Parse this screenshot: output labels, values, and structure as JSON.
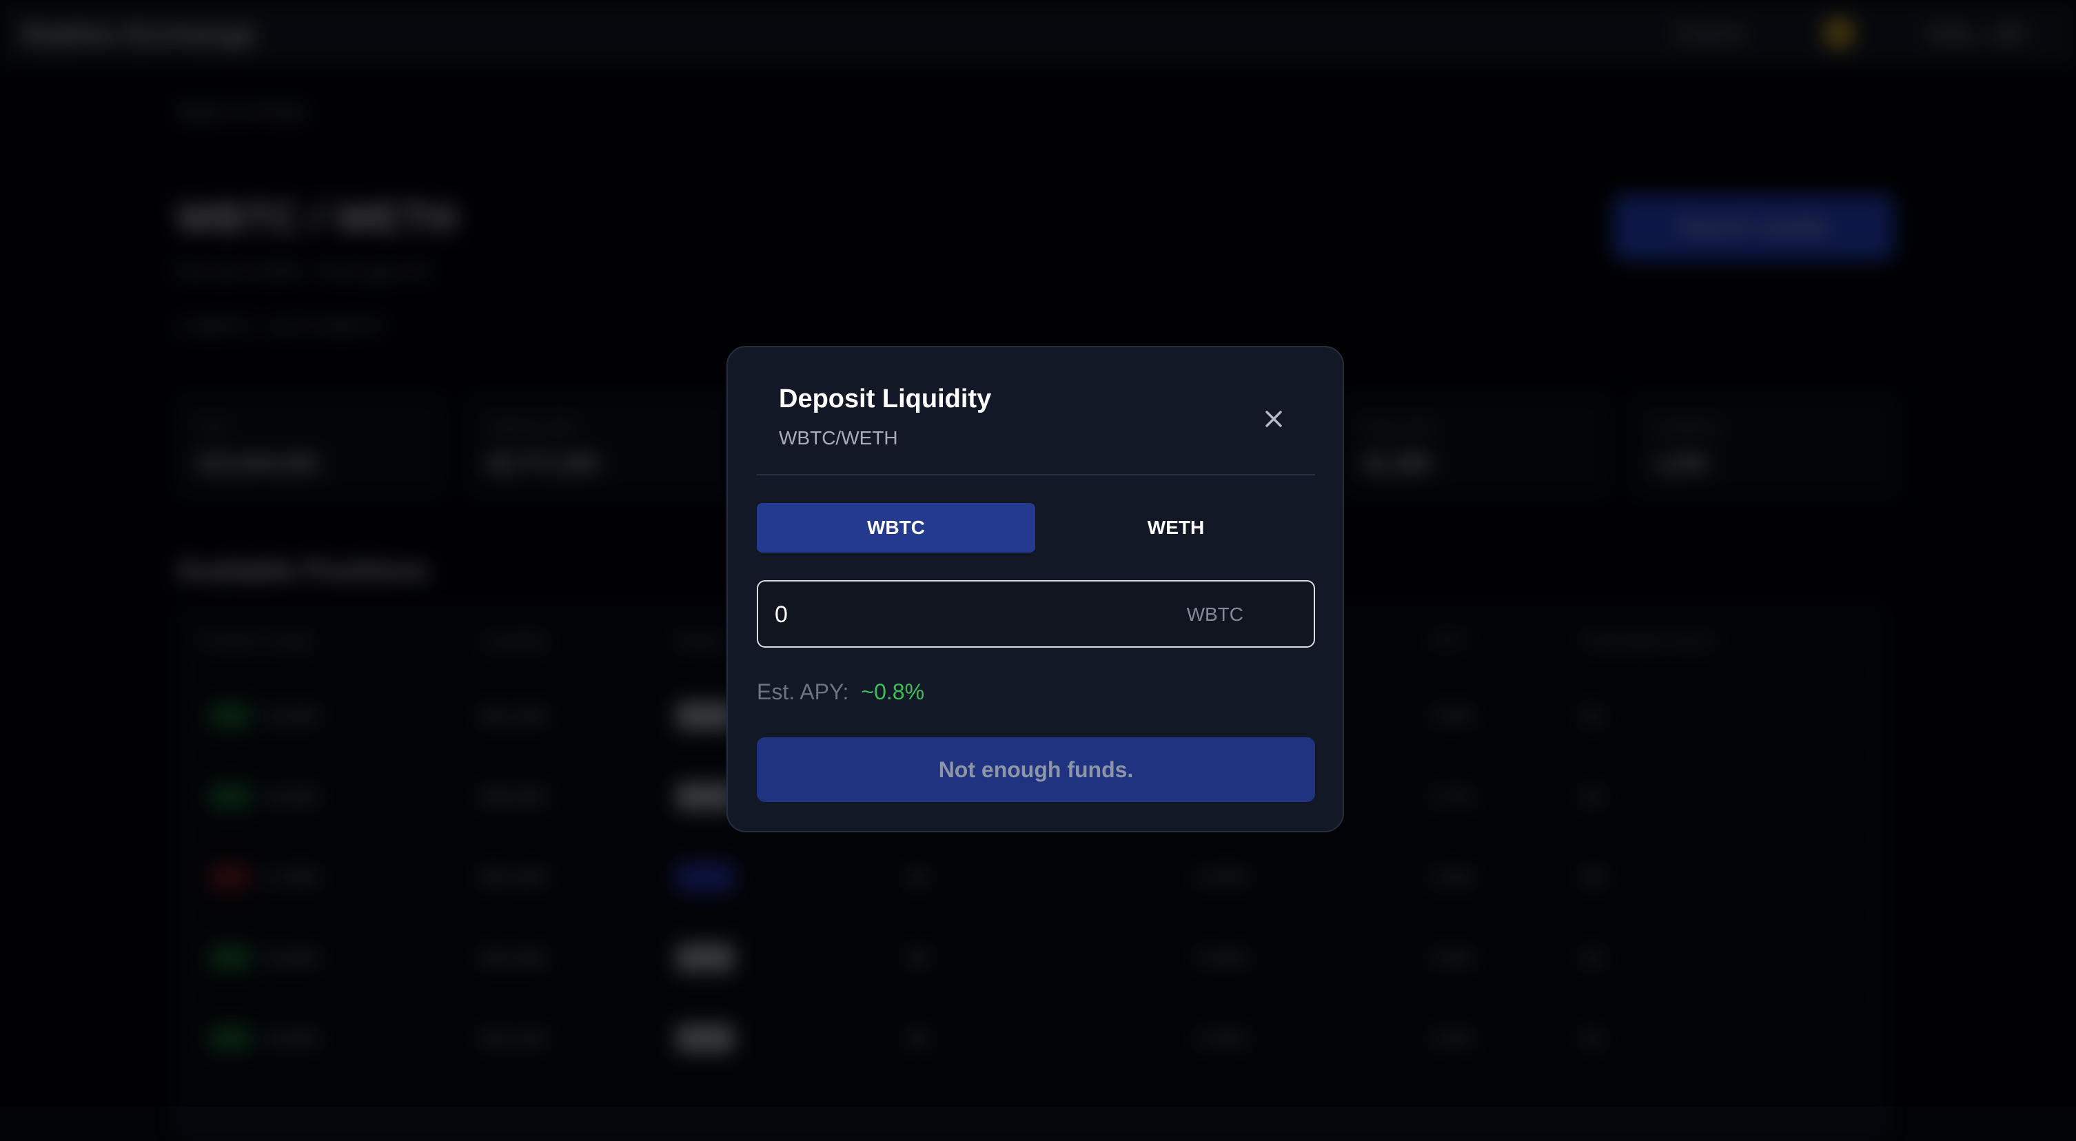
{
  "background": {
    "app_title": "Stables Exchange",
    "top_link": "Explore",
    "wallet": "0x4a…d21",
    "back_link": "Back to Pools",
    "pair_title": "WBTC / WETH",
    "pair_line1": "Fee tier 0.05% · Pool type V3",
    "pair_line2": "1 WBTC = 16.72 WETH",
    "cta_label": "Deposit Liquidity",
    "stats": [
      {
        "label": "TVL",
        "value": "$12,844,001"
      },
      {
        "label": "Volume 24h",
        "value": "$2,771,300"
      },
      {
        "label": "Fees 24h",
        "value": "$1,385"
      },
      {
        "label": "Positions",
        "value": "1,204"
      }
    ],
    "positions_heading": "Available Positions",
    "table_headers": [
      "Position range",
      "Liquidity",
      "Status",
      "Fees",
      "Share",
      "APY",
      "Estimated return"
    ],
    "rows": [
      {
        "range": "15,000",
        "liq": "$41,200",
        "status": "active",
        "fees": "$12",
        "share": "0.12%",
        "apy": "0.8%",
        "ret": "$1"
      },
      {
        "range": "16,000",
        "liq": "$38,900",
        "status": "active",
        "fees": "$10",
        "share": "0.11%",
        "apy": "0.7%",
        "ret": "$1"
      },
      {
        "range": "17,000",
        "liq": "$22,400",
        "status": "new",
        "fees": "$0",
        "share": "0.00%",
        "apy": "0.9%",
        "ret": "$0"
      },
      {
        "range": "18,000",
        "liq": "$19,300",
        "status": "active",
        "fees": "$8",
        "share": "0.08%",
        "apy": "0.6%",
        "ret": "$1"
      },
      {
        "range": "19,000",
        "liq": "$15,100",
        "status": "active",
        "fees": "$6",
        "share": "0.05%",
        "apy": "0.6%",
        "ret": "$1"
      }
    ]
  },
  "modal": {
    "title": "Deposit Liquidity",
    "subtitle": "WBTC/WETH",
    "close_icon": "close-icon",
    "tabs": [
      {
        "label": "WBTC",
        "active": true
      },
      {
        "label": "WETH",
        "active": false
      }
    ],
    "amount": {
      "value": "0",
      "unit": "WBTC"
    },
    "apy_label": "Est. APY:",
    "apy_value": "~0.8%",
    "submit_label": "Not enough funds."
  },
  "colors": {
    "modal_bg": "#131826",
    "active_tab": "#243a8f",
    "submit_bg": "#1f3380",
    "apy_green": "#3fbf5a"
  }
}
